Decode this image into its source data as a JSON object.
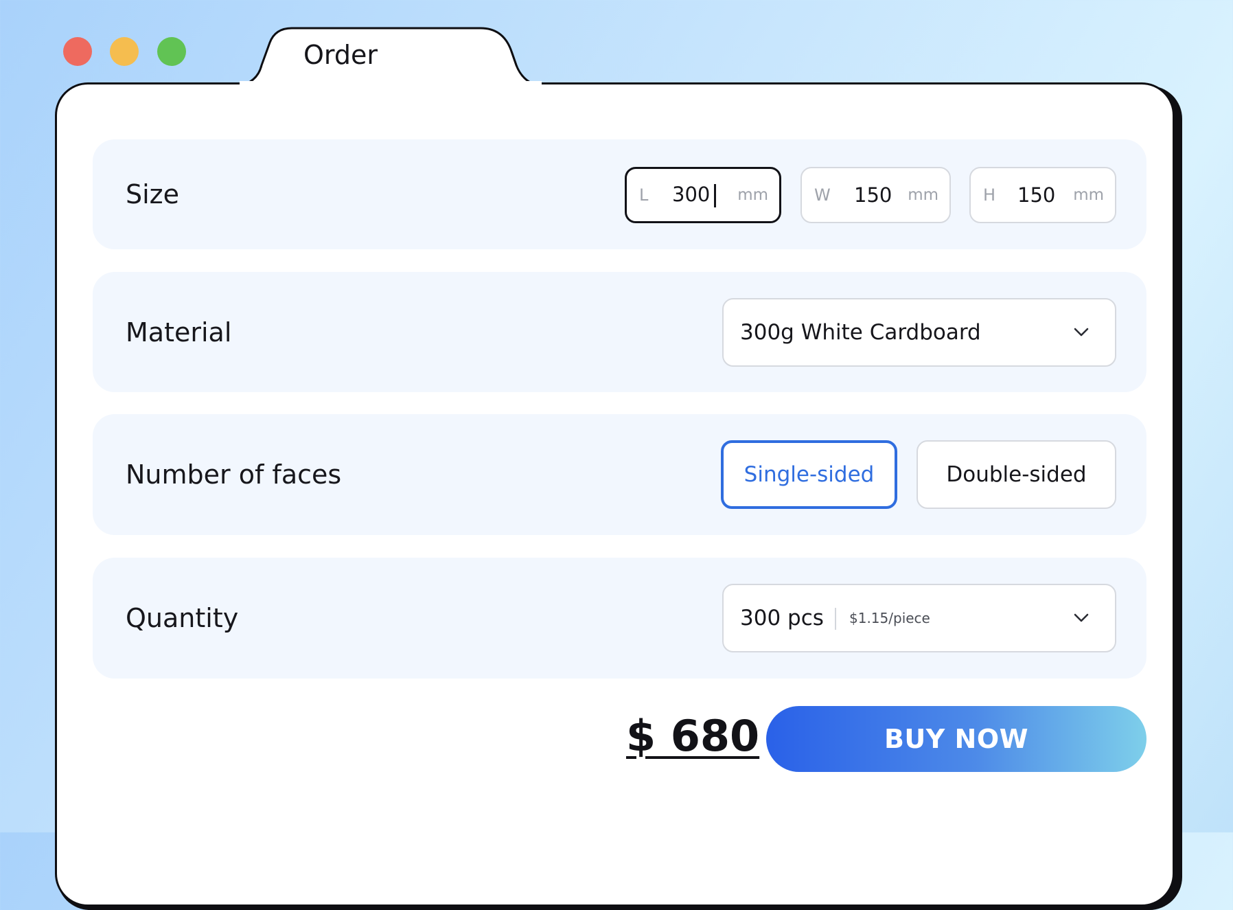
{
  "window": {
    "tab_title": "Order"
  },
  "size": {
    "label": "Size",
    "length": {
      "prefix": "L",
      "value": "300",
      "unit": "mm"
    },
    "width": {
      "prefix": "W",
      "value": "150",
      "unit": "mm"
    },
    "height": {
      "prefix": "H",
      "value": "150",
      "unit": "mm"
    }
  },
  "material": {
    "label": "Material",
    "selected": "300g White Cardboard"
  },
  "faces": {
    "label": "Number of faces",
    "options": [
      "Single-sided",
      "Double-sided"
    ],
    "selected": "Single-sided"
  },
  "quantity": {
    "label": "Quantity",
    "selected": "300 pcs",
    "unit_price": "$1.15/piece"
  },
  "footer": {
    "price": "$ 680",
    "buy_label": "BUY NOW"
  },
  "colors": {
    "accent": "#2f6ddf",
    "row_background": "#f2f7fe",
    "close": "#ee6a5f",
    "minimize": "#f5bd4f",
    "maximize": "#61c354"
  },
  "icons": {
    "select_arrow": "chevron-down-icon"
  }
}
